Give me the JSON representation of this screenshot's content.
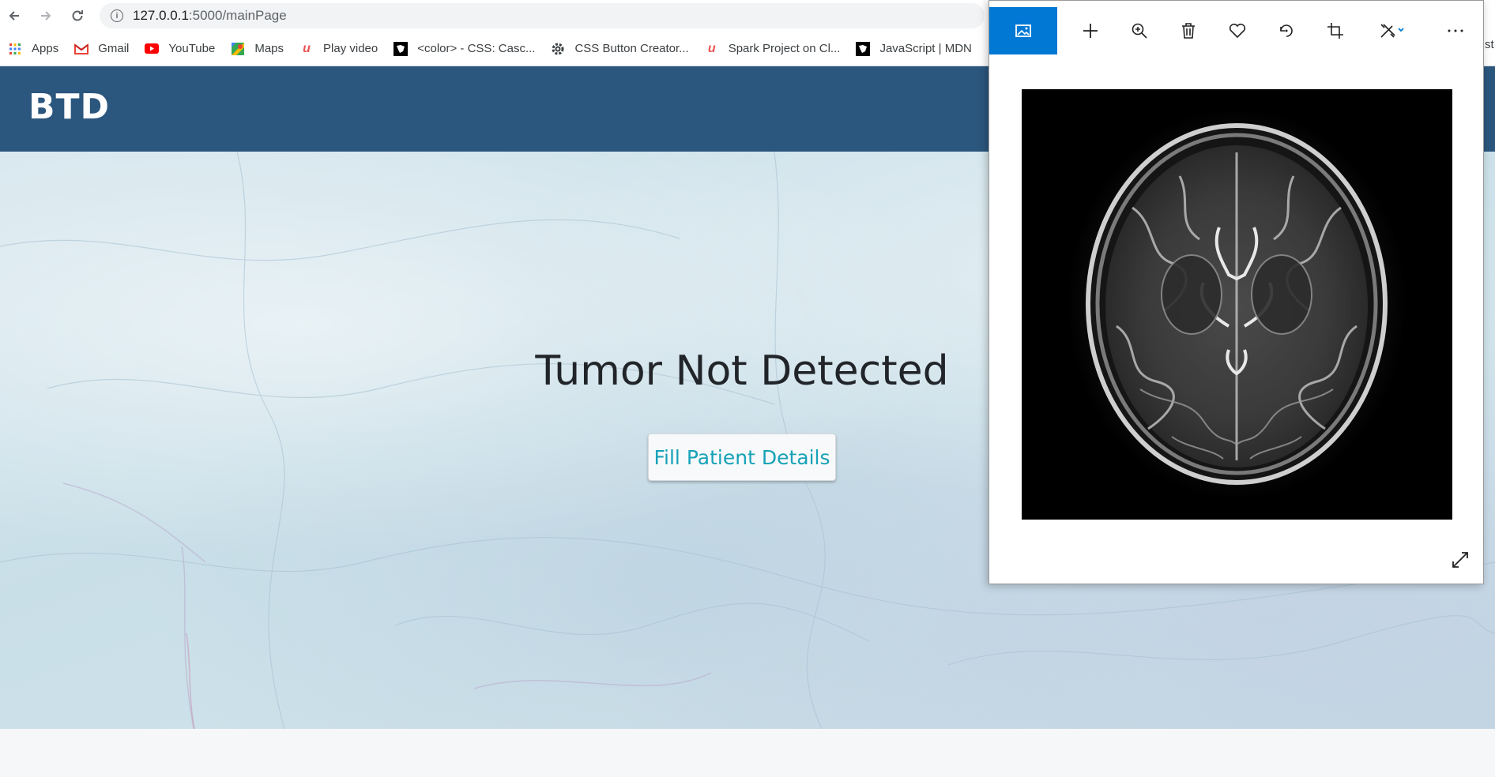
{
  "browser": {
    "url_host": "127.0.0.1",
    "url_path": ":5000/mainPage",
    "bookmarks": [
      {
        "label": "Apps",
        "icon": "apps-grid-icon"
      },
      {
        "label": "Gmail",
        "icon": "gmail-icon"
      },
      {
        "label": "YouTube",
        "icon": "youtube-icon"
      },
      {
        "label": "Maps",
        "icon": "maps-icon"
      },
      {
        "label": "Play video",
        "icon": "udemy-icon"
      },
      {
        "label": "<color> - CSS: Casc...",
        "icon": "mdn-icon"
      },
      {
        "label": "CSS Button Creator...",
        "icon": "gear-icon"
      },
      {
        "label": "Spark Project on Cl...",
        "icon": "udemy-icon"
      },
      {
        "label": "JavaScript | MDN",
        "icon": "mdn-icon"
      }
    ],
    "edge_text": "st"
  },
  "app": {
    "brand": "BTD",
    "result_title": "Tumor Not Detected",
    "fill_button_label": "Fill Patient Details"
  },
  "viewer": {
    "toolbar": [
      "see-image-icon",
      "add-icon",
      "zoom-icon",
      "delete-icon",
      "favorite-icon",
      "rotate-icon",
      "crop-icon",
      "edit-icon",
      "more-icon"
    ],
    "accent": "#0078d4"
  },
  "colors": {
    "header": "#2b567d",
    "button_text": "#17a2b8",
    "title_text": "#212529"
  }
}
